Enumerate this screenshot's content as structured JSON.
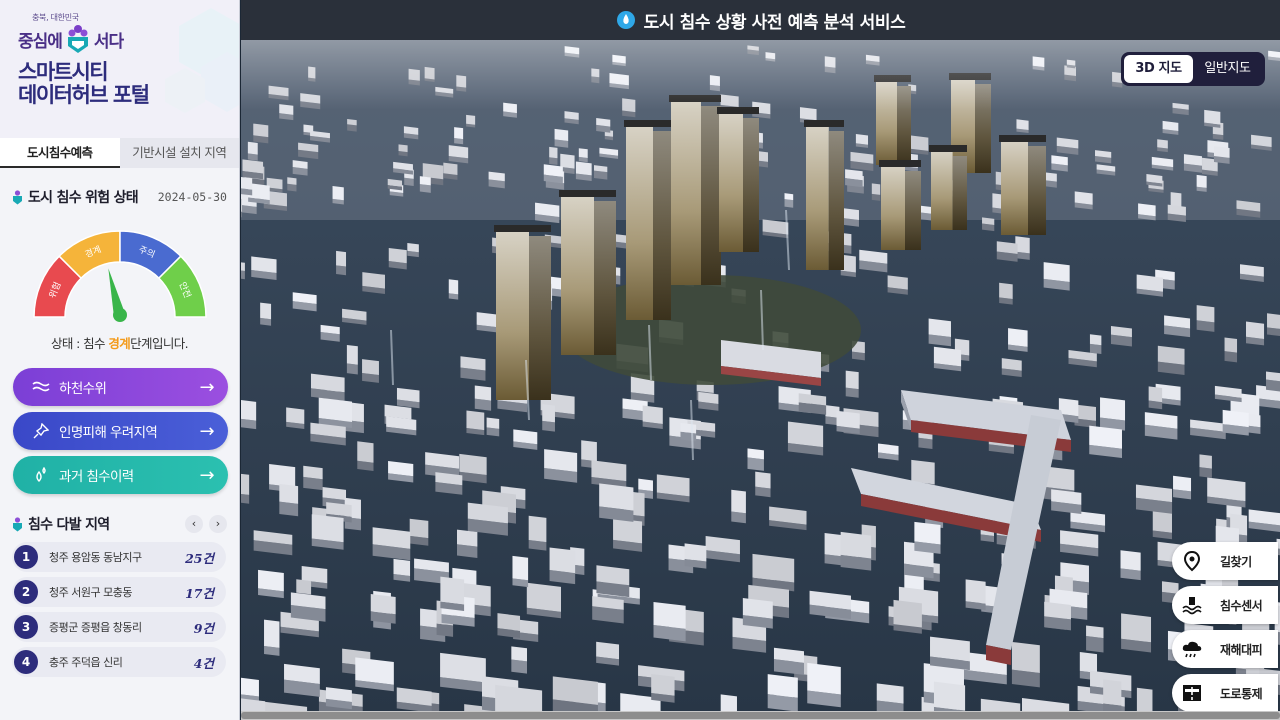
{
  "brand": {
    "region": "충북, 대한민국",
    "slogan_left": "중심에",
    "slogan_right": "서다",
    "title_line1": "스마트시티",
    "title_line2": "데이터허브 포털"
  },
  "tabs": [
    {
      "label": "도시침수예측",
      "active": true
    },
    {
      "label": "기반시설 설치 지역",
      "active": false
    }
  ],
  "risk": {
    "title": "도시 침수 위험 상태",
    "date": "2024-05-30",
    "gauge_segments": [
      {
        "label": "위험",
        "color": "#e84a4f"
      },
      {
        "label": "경계",
        "color": "#f5b43a"
      },
      {
        "label": "주의",
        "color": "#4a6bd0"
      },
      {
        "label": "안전",
        "color": "#6fcf4a"
      }
    ],
    "status_prefix": "상태 : 침수 ",
    "status_level": "경계",
    "status_suffix": "단계입니다."
  },
  "menu_buttons": [
    {
      "label": "하천수위",
      "icon": "wave-icon"
    },
    {
      "label": "인명피해 우려지역",
      "icon": "pin-icon"
    },
    {
      "label": "과거 침수이력",
      "icon": "drops-icon"
    }
  ],
  "frequent": {
    "title": "침수 다발 지역",
    "prev": "‹",
    "next": "›",
    "items": [
      {
        "rank": "1",
        "name": "청주 용암동 동남지구",
        "count": "25건"
      },
      {
        "rank": "2",
        "name": "청주 서원구 모충동",
        "count": "17건"
      },
      {
        "rank": "3",
        "name": "증평군 증평읍 창동리",
        "count": "9건"
      },
      {
        "rank": "4",
        "name": "충주 주덕읍 신리",
        "count": "4건"
      }
    ]
  },
  "header": {
    "title": "도시 침수 상황 사전 예측 분석 서비스"
  },
  "map_toggle": {
    "option_3d": "3D 지도",
    "option_general": "일반지도",
    "selected": "3D 지도"
  },
  "tools": [
    {
      "label": "길찾기",
      "icon": "location-pin-icon"
    },
    {
      "label": "침수센서",
      "icon": "flood-sensor-icon"
    },
    {
      "label": "재해대피",
      "icon": "rain-cloud-icon"
    },
    {
      "label": "도로통제",
      "icon": "road-control-icon"
    }
  ]
}
